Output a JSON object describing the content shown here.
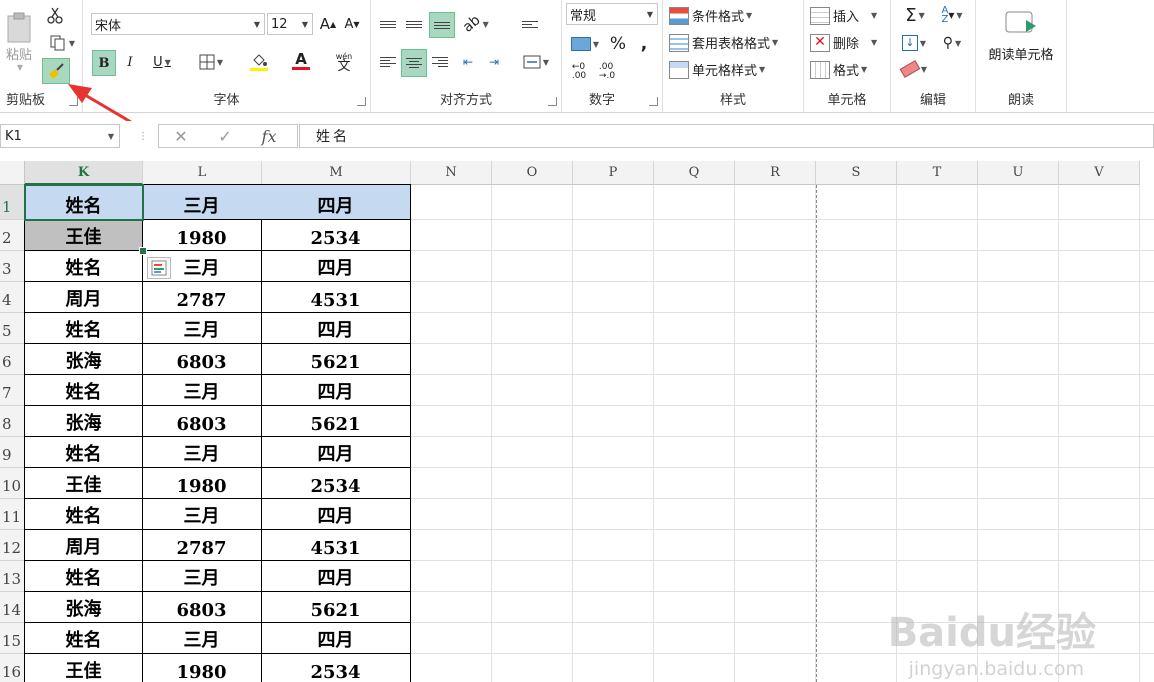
{
  "ribbon": {
    "clipboard": {
      "paste": "粘贴",
      "label": "剪贴板"
    },
    "font": {
      "name": "宋体",
      "size": "12",
      "label": "字体",
      "bold": "B",
      "italic": "I",
      "underline": "U",
      "grow": "A",
      "shrink": "A",
      "color_letter": "A",
      "phonetic": "wén",
      "phonetic_char": "文"
    },
    "alignment": {
      "label": "对齐方式"
    },
    "number": {
      "format": "常规",
      "percent": "%",
      "comma": ",",
      "label": "数字"
    },
    "styles": {
      "conditional": "条件格式",
      "table": "套用表格格式",
      "cell": "单元格样式",
      "label": "样式"
    },
    "cells": {
      "insert": "插入",
      "delete": "删除",
      "format": "格式",
      "label": "单元格"
    },
    "editing": {
      "sum": "Σ",
      "label": "编辑"
    },
    "read": {
      "button": "朗读单元格",
      "label": "朗读"
    },
    "accent": "#217346",
    "highlight": "#a9d8c0",
    "font_color": "#e81123"
  },
  "formula_bar": {
    "name_box": "K1",
    "content": "姓名",
    "fx": "fx"
  },
  "columns": [
    "K",
    "L",
    "M",
    "N",
    "O",
    "P",
    "Q",
    "R",
    "S",
    "T",
    "U",
    "V"
  ],
  "rows": [
    "1",
    "2",
    "3",
    "4",
    "5",
    "6",
    "7",
    "8",
    "9",
    "10",
    "11",
    "12",
    "13",
    "14",
    "15",
    "16"
  ],
  "table": [
    [
      "姓名",
      "三月",
      "四月"
    ],
    [
      "王佳",
      "1980",
      "2534"
    ],
    [
      "姓名",
      "三月",
      "四月"
    ],
    [
      "周月",
      "2787",
      "4531"
    ],
    [
      "姓名",
      "三月",
      "四月"
    ],
    [
      "张海",
      "6803",
      "5621"
    ],
    [
      "姓名",
      "三月",
      "四月"
    ],
    [
      "张海",
      "6803",
      "5621"
    ],
    [
      "姓名",
      "三月",
      "四月"
    ],
    [
      "王佳",
      "1980",
      "2534"
    ],
    [
      "姓名",
      "三月",
      "四月"
    ],
    [
      "周月",
      "2787",
      "4531"
    ],
    [
      "姓名",
      "三月",
      "四月"
    ],
    [
      "张海",
      "6803",
      "5621"
    ],
    [
      "姓名",
      "三月",
      "四月"
    ],
    [
      "王佳",
      "1980",
      "2534"
    ]
  ],
  "header_fill": "#c5d9f1",
  "watermark": {
    "main": "Baidu经验",
    "sub": "jingyan.baidu.com"
  }
}
